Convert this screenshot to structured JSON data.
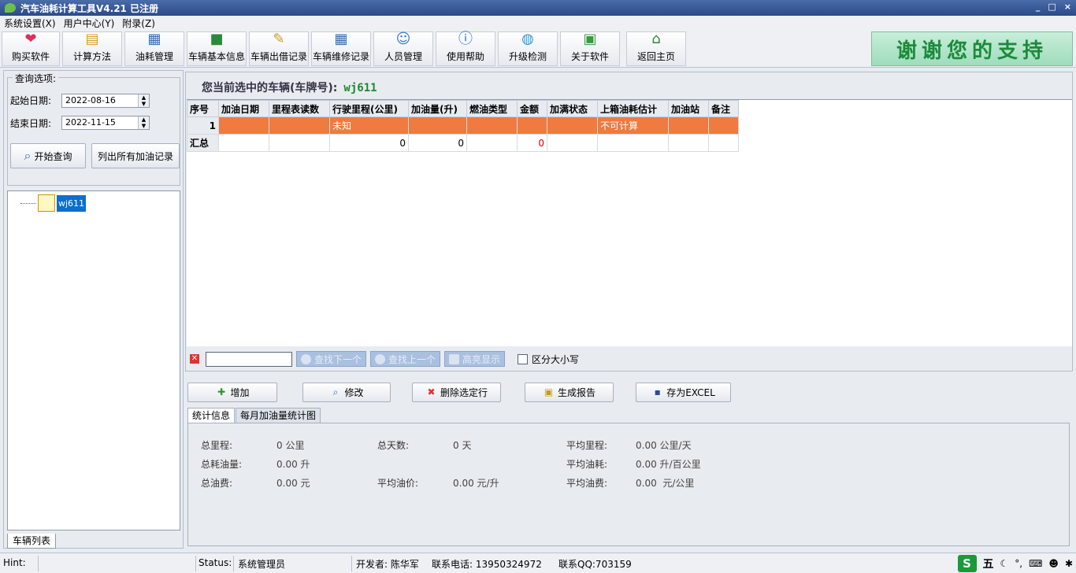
{
  "window": {
    "title": "汽车油耗计算工具V4.21 已注册",
    "minimize": "_",
    "maximize": "□",
    "close": "×"
  },
  "menu": [
    "系统设置(X)",
    "用户中心(Y)",
    "附录(Z)"
  ],
  "toolbar": [
    {
      "label": "购买软件",
      "icon": "heart-icon",
      "color": "#e0305a"
    },
    {
      "label": "计算方法",
      "icon": "document-icon",
      "color": "#d4a020"
    },
    {
      "label": "油耗管理",
      "icon": "grid-icon",
      "color": "#3a6ab0"
    },
    {
      "label": "车辆基本信息",
      "icon": "truck-icon",
      "color": "#2a8a3a"
    },
    {
      "label": "车辆出借记录",
      "icon": "notepad-icon",
      "color": "#c89a20"
    },
    {
      "label": "车辆维修记录",
      "icon": "table-icon",
      "color": "#3a6ab0"
    },
    {
      "label": "人员管理",
      "icon": "person-card-icon",
      "color": "#3a7ac0"
    },
    {
      "label": "使用帮助",
      "icon": "info-icon",
      "color": "#2a6ad0"
    },
    {
      "label": "升级检测",
      "icon": "globe-icon",
      "color": "#2a9ad0"
    },
    {
      "label": "关于软件",
      "icon": "certificate-icon",
      "color": "#3a9a3a"
    },
    {
      "label": "返回主页",
      "icon": "home-icon",
      "color": "#2a8a3a"
    }
  ],
  "banner": "谢谢您的支持",
  "query": {
    "legend": "查询选项:",
    "start_label": "起始日期:",
    "start_value": "2022-08-16",
    "end_label": "结束日期:",
    "end_value": "2022-11-15",
    "search_btn": "开始查询",
    "list_all_btn": "列出所有加油记录"
  },
  "tree": {
    "node": "wj611"
  },
  "left_tab": "车辆列表",
  "selected": {
    "prefix": "您当前选中的车辆(车牌号):",
    "plate": "wj611"
  },
  "grid": {
    "headers": [
      "序号",
      "加油日期",
      "里程表读数",
      "行驶里程(公里)",
      "加油量(升)",
      "燃油类型",
      "金额",
      "加满状态",
      "上箱油耗估计",
      "加油站",
      "备注"
    ],
    "row": [
      "1",
      "",
      "",
      "未知",
      "",
      "",
      "",
      "",
      "不可计算",
      "",
      ""
    ],
    "total": [
      "汇总",
      "",
      "",
      "0",
      "0",
      "",
      "0",
      "",
      "",
      "",
      ""
    ]
  },
  "find": {
    "next": "查找下一个",
    "prev": "查找上一个",
    "highlight": "高亮显示",
    "case": "区分大小写"
  },
  "actions": {
    "add": "增加",
    "edit": "修改",
    "delete": "删除选定行",
    "report": "生成报告",
    "excel": "存为EXCEL"
  },
  "tabs": [
    "统计信息",
    "每月加油量统计图"
  ],
  "stats": {
    "total_distance_label": "总里程:",
    "total_distance": "0 公里",
    "total_days_label": "总天数:",
    "total_days": "0 天",
    "avg_distance_label": "平均里程:",
    "avg_distance": "0.00 公里/天",
    "total_fuel_label": "总耗油量:",
    "total_fuel": "0.00 升",
    "avg_consumption_label": "平均油耗:",
    "avg_consumption": "0.00 升/百公里",
    "total_cost_label": "总油费:",
    "total_cost": "0.00 元",
    "avg_price_label": "平均油价:",
    "avg_price": "0.00 元/升",
    "avg_cost_label": "平均油费:",
    "avg_cost": "0.00  元/公里"
  },
  "status": {
    "hint": "Hint:",
    "status_label": "Status:",
    "status_value": "系统管理员",
    "developer": "开发者: 陈华军",
    "phone": "联系电话: 13950324972",
    "qq": "联系QQ:703159"
  },
  "ime": {
    "logo": "S",
    "mode": "五",
    "icons": [
      "moon-icon",
      "punctuation-icon",
      "keyboard-icon",
      "user-icon",
      "settings-icon"
    ]
  }
}
